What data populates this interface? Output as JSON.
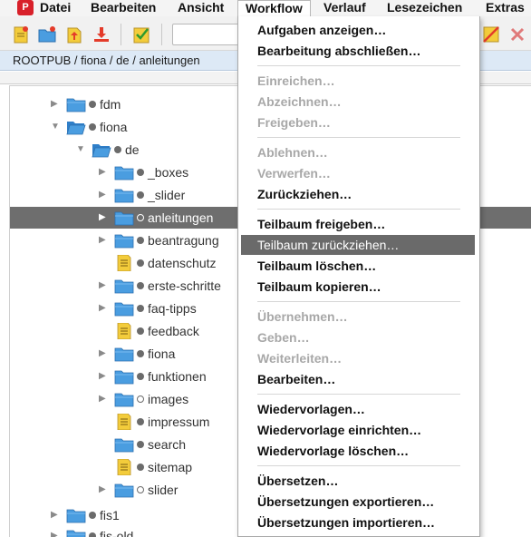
{
  "menubar": {
    "logo_text": "P",
    "items": [
      "Datei",
      "Bearbeiten",
      "Ansicht",
      "Workflow",
      "Verlauf",
      "Lesezeichen",
      "Extras"
    ]
  },
  "toolbar": {
    "buttons": [
      "new-document-icon",
      "new-folder-icon",
      "upload-icon",
      "download-icon",
      "checklist-icon",
      "no-edit-icon",
      "close-icon"
    ]
  },
  "breadcrumb": {
    "path": "ROOTPUB / fiona / de / anleitungen"
  },
  "tree": {
    "rows": [
      {
        "label": "fdm",
        "type": "folder",
        "twisty": "collapsed",
        "dot": "filled"
      },
      {
        "label": "fiona",
        "type": "folder-open",
        "twisty": "expanded",
        "dot": "filled"
      },
      {
        "label": "de",
        "type": "folder-open",
        "twisty": "expanded",
        "dot": "filled"
      },
      {
        "label": "_boxes",
        "type": "folder",
        "twisty": "collapsed",
        "dot": "filled"
      },
      {
        "label": "_slider",
        "type": "folder",
        "twisty": "collapsed",
        "dot": "filled"
      },
      {
        "label": "anleitungen",
        "type": "folder",
        "twisty": "collapsed",
        "dot": "hollow",
        "selected": true
      },
      {
        "label": "beantragung",
        "type": "folder",
        "twisty": "collapsed",
        "dot": "filled"
      },
      {
        "label": "datenschutz",
        "type": "document",
        "twisty": "none",
        "dot": "filled"
      },
      {
        "label": "erste-schritte",
        "type": "folder",
        "twisty": "collapsed",
        "dot": "filled"
      },
      {
        "label": "faq-tipps",
        "type": "folder",
        "twisty": "collapsed",
        "dot": "filled"
      },
      {
        "label": "feedback",
        "type": "document",
        "twisty": "none",
        "dot": "filled"
      },
      {
        "label": "fiona",
        "type": "folder",
        "twisty": "collapsed",
        "dot": "filled"
      },
      {
        "label": "funktionen",
        "type": "folder",
        "twisty": "collapsed",
        "dot": "filled"
      },
      {
        "label": "images",
        "type": "folder",
        "twisty": "collapsed",
        "dot": "hollow"
      },
      {
        "label": "impressum",
        "type": "document",
        "twisty": "none",
        "dot": "filled"
      },
      {
        "label": "search",
        "type": "folder",
        "twisty": "none",
        "dot": "filled"
      },
      {
        "label": "sitemap",
        "type": "document",
        "twisty": "none",
        "dot": "filled"
      },
      {
        "label": "slider",
        "type": "folder",
        "twisty": "collapsed",
        "dot": "hollow"
      },
      {
        "label": "fis1",
        "type": "folder",
        "twisty": "collapsed",
        "dot": "filled"
      },
      {
        "label": "fis-old",
        "type": "folder",
        "twisty": "collapsed",
        "dot": "filled"
      }
    ]
  },
  "workflow_menu": {
    "items": [
      {
        "label": "Aufgaben anzeigen…",
        "state": "enabled"
      },
      {
        "label": "Bearbeitung abschließen…",
        "state": "enabled"
      },
      {
        "sep": true
      },
      {
        "label": "Einreichen…",
        "state": "disabled"
      },
      {
        "label": "Abzeichnen…",
        "state": "disabled"
      },
      {
        "label": "Freigeben…",
        "state": "disabled"
      },
      {
        "sep": true
      },
      {
        "label": "Ablehnen…",
        "state": "disabled"
      },
      {
        "label": "Verwerfen…",
        "state": "disabled"
      },
      {
        "label": "Zurückziehen…",
        "state": "enabled"
      },
      {
        "sep": true
      },
      {
        "label": "Teilbaum freigeben…",
        "state": "enabled"
      },
      {
        "label": "Teilbaum zurückziehen…",
        "state": "highlighted"
      },
      {
        "label": "Teilbaum löschen…",
        "state": "enabled"
      },
      {
        "label": "Teilbaum kopieren…",
        "state": "enabled"
      },
      {
        "sep": true
      },
      {
        "label": "Übernehmen…",
        "state": "disabled"
      },
      {
        "label": "Geben…",
        "state": "disabled"
      },
      {
        "label": "Weiterleiten…",
        "state": "disabled"
      },
      {
        "label": "Bearbeiten…",
        "state": "enabled"
      },
      {
        "sep": true
      },
      {
        "label": "Wiedervorlagen…",
        "state": "enabled"
      },
      {
        "label": "Wiedervorlage einrichten…",
        "state": "enabled"
      },
      {
        "label": "Wiedervorlage löschen…",
        "state": "enabled"
      },
      {
        "sep": true
      },
      {
        "label": "Übersetzen…",
        "state": "enabled"
      },
      {
        "label": "Übersetzungen exportieren…",
        "state": "enabled"
      },
      {
        "label": "Übersetzungen importieren…",
        "state": "enabled"
      }
    ]
  },
  "colors": {
    "breadcrumb_bg": "#dde9f6",
    "selection": "#6e6e6e",
    "folder_blue": "#4a9de0",
    "document_yellow": "#f3cc3b",
    "logo_red": "#d8202a"
  }
}
